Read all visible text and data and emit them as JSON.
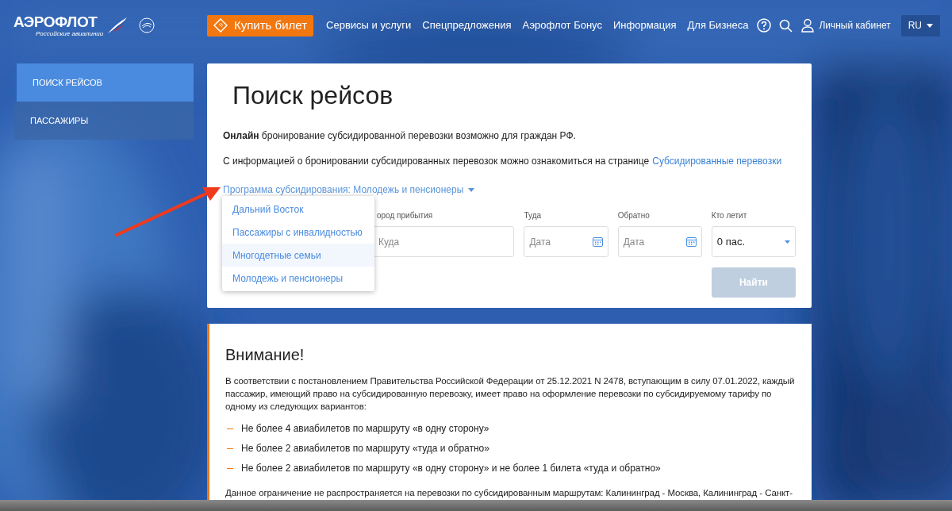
{
  "header": {
    "logo": {
      "name": "АЭРОФЛОТ",
      "tagline": "Российские авиалинии"
    },
    "buy_button": "Купить билет",
    "nav": [
      "Сервисы и услуги",
      "Спецпредложения",
      "Аэрофлот Бонус",
      "Информация",
      "Для Бизнеса"
    ],
    "account": "Личный кабинет",
    "language": "RU"
  },
  "sidebar": {
    "items": [
      {
        "label": "ПОИСК РЕЙСОВ",
        "selected": true
      },
      {
        "label": "ПАССАЖИРЫ",
        "selected": false
      }
    ]
  },
  "search": {
    "title": "Поиск рейсов",
    "intro": "**Онлайн** бронирование субсидированной перевозки возможно для граждан РФ.",
    "info_text": "С информацией о бронировании субсидированных перевозок можно ознакомиться на странице",
    "info_link": "Субсидированные перевозки",
    "program_selector": "Программа субсидирования: Молодежь и пенсионеры",
    "dropdown": [
      {
        "label": "Дальний Восток",
        "highlighted": false
      },
      {
        "label": "Пассажиры с инвалидностью",
        "highlighted": false
      },
      {
        "label": "Многодетные семьи",
        "highlighted": true
      },
      {
        "label": "Молодежь и пенсионеры",
        "highlighted": false
      }
    ],
    "fields": [
      {
        "kind": "text",
        "label": "ород прибытия",
        "placeholder": "Куда"
      },
      {
        "kind": "date",
        "label": "Туда",
        "placeholder": "Дата"
      },
      {
        "kind": "date",
        "label": "Обратно",
        "placeholder": "Дата"
      },
      {
        "kind": "select",
        "label": "Кто летит",
        "value": "0 пас."
      }
    ],
    "submit": {
      "label": "Найти",
      "disabled": true
    }
  },
  "notice": {
    "title": "Внимание!",
    "intro": "В соответствии с постановлением Правительства Российской Федерации от 25.12.2021 N 2478, вступающим в силу 07.01.2022, каждый пассажир, имеющий право на субсидированную перевозку, имеет право на оформление перевозки по субсидируемому тарифу по одному из следующих вариантов:",
    "items": [
      "Не более 4 авиабилетов по маршруту «в одну сторону»",
      "Не более 2 авиабилетов по маршруту «туда и обратно»",
      "Не более 2 авиабилетов по маршруту «в одну сторону» и не более 1 билета «туда и обратно»"
    ],
    "footer_text": "Данное ограничение не распространяется на перевозки по субсидированным маршрутам: Калининград - Москва, Калининград - Санкт-"
  }
}
